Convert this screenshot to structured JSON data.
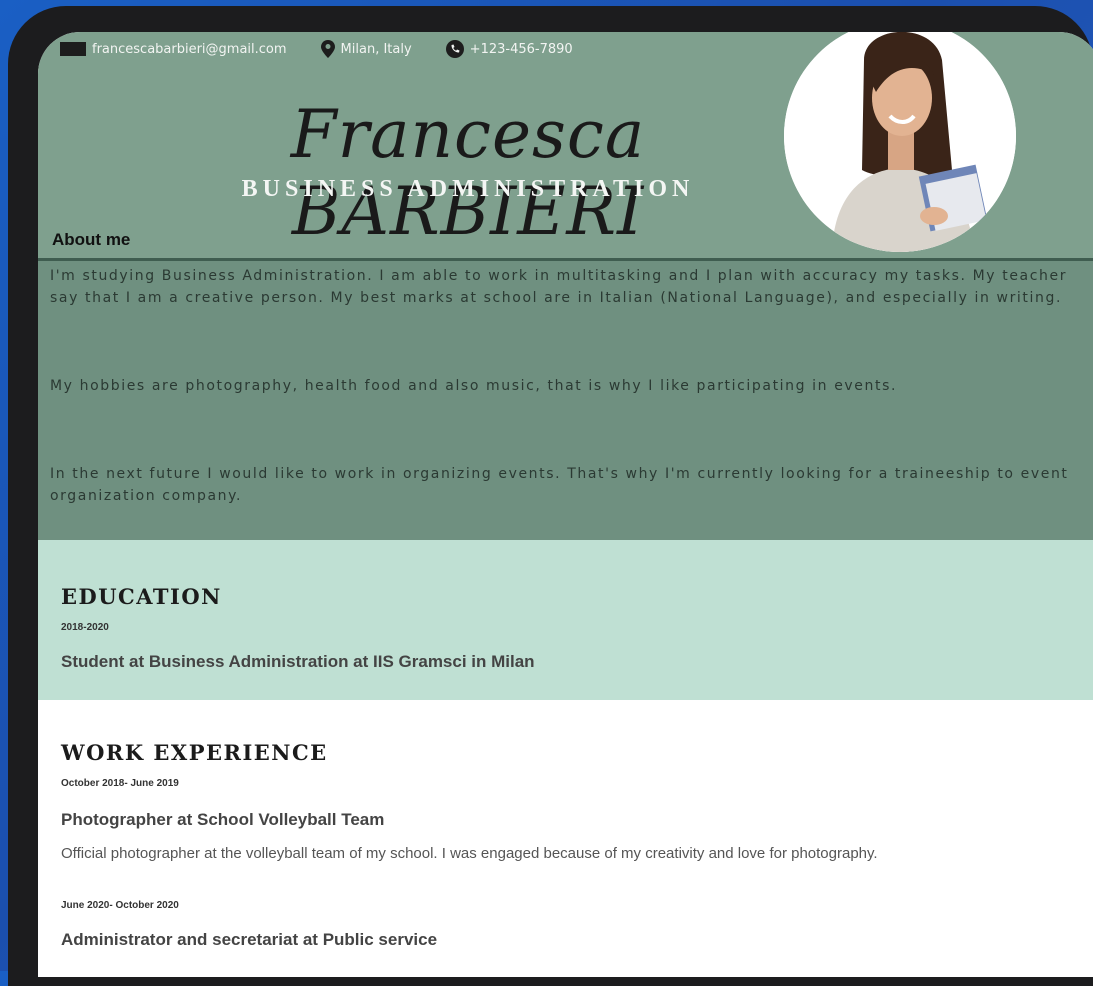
{
  "contacts": {
    "email": "francescabarbieri@gmail.com",
    "location": "Milan, Italy",
    "phone": "+123-456-7890"
  },
  "header": {
    "name": "Francesca BARBIERI",
    "role": "BUSINESS ADMINISTRATION"
  },
  "about": {
    "title": "About me",
    "paragraph_1": "I'm studying Business Administration. I am able to work in multitasking and I plan with accuracy my tasks. My teacher say that I am a creative person. My best marks at school are in Italian (National Language), and especially in writing.",
    "paragraph_2": "My hobbies are photography, health food and also music, that is why I like participating in events.",
    "paragraph_3": "In the next future I would like to work in organizing events. That's why I'm currently looking for a traineeship to event organization company."
  },
  "education": {
    "title": "EDUCATION",
    "entries": [
      {
        "date": "2018-2020",
        "title": "Student at Business  Administration at IIS Gramsci in Milan"
      }
    ]
  },
  "work": {
    "title": "WORK EXPERIENCE",
    "entries": [
      {
        "date": "October 2018- June 2019",
        "title": "Photographer at School Volleyball Team",
        "description": "Official photographer at the volleyball team of my school. I was engaged because of my creativity and love for photography."
      },
      {
        "date": "June 2020- October 2020",
        "title": "Administrator and secretariat at Public service"
      }
    ]
  },
  "colors": {
    "page_background": "#1b4fae",
    "header_green": "#7fa08e",
    "about_green": "#6f9080",
    "education_mint": "#bfe0d3"
  },
  "icons": [
    "email-icon",
    "location-pin-icon",
    "phone-icon"
  ]
}
